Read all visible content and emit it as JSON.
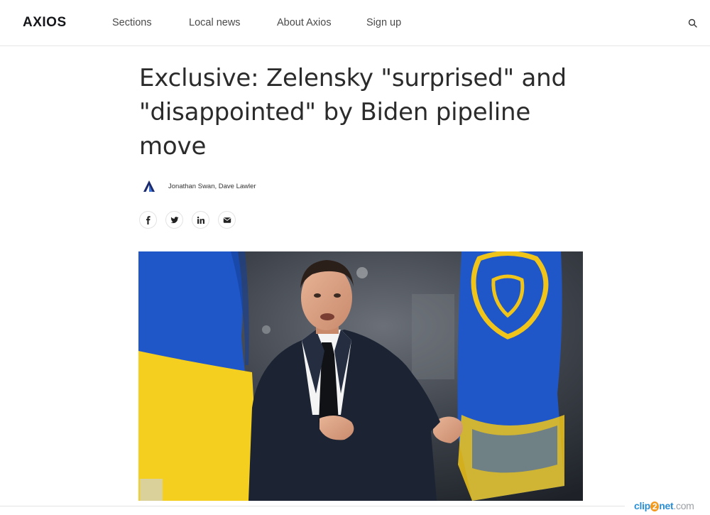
{
  "header": {
    "logo": "AXIOS",
    "nav": [
      "Sections",
      "Local news",
      "About Axios",
      "Sign up"
    ]
  },
  "article": {
    "headline": "Exclusive: Zelensky \"surprised\" and \"disappointed\" by Biden pipeline move",
    "authors": "Jonathan Swan, Dave Lawler"
  },
  "share": {
    "icons": [
      "facebook-icon",
      "twitter-icon",
      "linkedin-icon",
      "email-icon"
    ]
  },
  "watermark": {
    "clip": "clip",
    "two": "2",
    "net": "net",
    "com": ".com"
  },
  "colors": {
    "flag_blue": "#1f57c8",
    "flag_yellow": "#f5cf1f",
    "suit": "#1c2333",
    "text": "#2b2b2b"
  }
}
